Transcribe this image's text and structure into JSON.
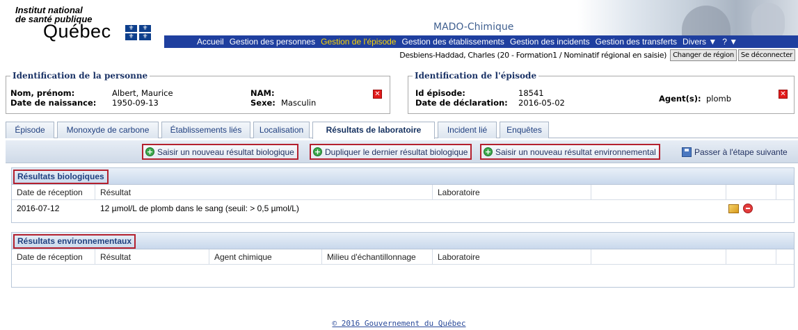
{
  "header": {
    "org_line1": "Institut national",
    "org_line2": "de santé publique",
    "org_line3": "Québec",
    "app_title": "MADO-Chimique"
  },
  "nav": {
    "items": [
      {
        "label": "Accueil",
        "active": false
      },
      {
        "label": "Gestion des personnes",
        "active": false
      },
      {
        "label": "Gestion de l'épisode",
        "active": true
      },
      {
        "label": "Gestion des établissements",
        "active": false
      },
      {
        "label": "Gestion des incidents",
        "active": false
      },
      {
        "label": "Gestion des transferts",
        "active": false
      },
      {
        "label": "Divers ▼",
        "active": false
      },
      {
        "label": "? ▼",
        "active": false
      }
    ]
  },
  "user": {
    "info": "Desbiens-Haddad, Charles (20 - Formation1 / Nominatif régional en saisie)",
    "change_region": "Changer de région",
    "logout": "Se déconnecter"
  },
  "person": {
    "legend": "Identification de la personne",
    "name_label": "Nom, prénom:",
    "name_value": "Albert, Maurice",
    "dob_label": "Date de naissance:",
    "dob_value": "1950-09-13",
    "nam_label": "NAM:",
    "nam_value": "",
    "sex_label": "Sexe:",
    "sex_value": "Masculin"
  },
  "episode": {
    "legend": "Identification de l'épisode",
    "id_label": "Id épisode:",
    "id_value": "18541",
    "decl_label": "Date de déclaration:",
    "decl_value": "2016-05-02",
    "agent_label": "Agent(s):",
    "agent_value": "plomb"
  },
  "tabs": [
    {
      "label": "Épisode",
      "active": false
    },
    {
      "label": "Monoxyde de carbone",
      "active": false
    },
    {
      "label": "Établissements liés",
      "active": false
    },
    {
      "label": "Localisation",
      "active": false
    },
    {
      "label": "Résultats de laboratoire",
      "active": true
    },
    {
      "label": "Incident lié",
      "active": false
    },
    {
      "label": "Enquêtes",
      "active": false
    }
  ],
  "toolbar": {
    "new_bio": "Saisir un nouveau résultat biologique",
    "dup_bio": "Dupliquer le dernier résultat biologique",
    "new_env": "Saisir un nouveau résultat environnemental",
    "next_step": "Passer à l'étape suivante"
  },
  "bio": {
    "title": "Résultats biologiques",
    "columns": [
      "Date de réception",
      "Résultat",
      "Laboratoire"
    ],
    "rows": [
      {
        "date": "2016-07-12",
        "result": "12 µmol/L de plomb dans le sang (seuil: > 0,5 µmol/L)",
        "lab": ""
      }
    ]
  },
  "env": {
    "title": "Résultats environnementaux",
    "columns": [
      "Date de réception",
      "Résultat",
      "Agent chimique",
      "Milieu d'échantillonnage",
      "Laboratoire"
    ]
  },
  "footer": {
    "copyright": "© 2016 Gouvernement du Québec"
  },
  "colors": {
    "nav_bg": "#1f3f9f",
    "nav_active": "#ffd800",
    "highlight_border": "#b4202e",
    "legend_text": "#1b3366"
  },
  "icons": [
    "quebec-flag-icon",
    "close-x-icon",
    "add-circle-icon",
    "save-disk-icon",
    "edit-pencil-icon",
    "delete-circle-icon"
  ]
}
